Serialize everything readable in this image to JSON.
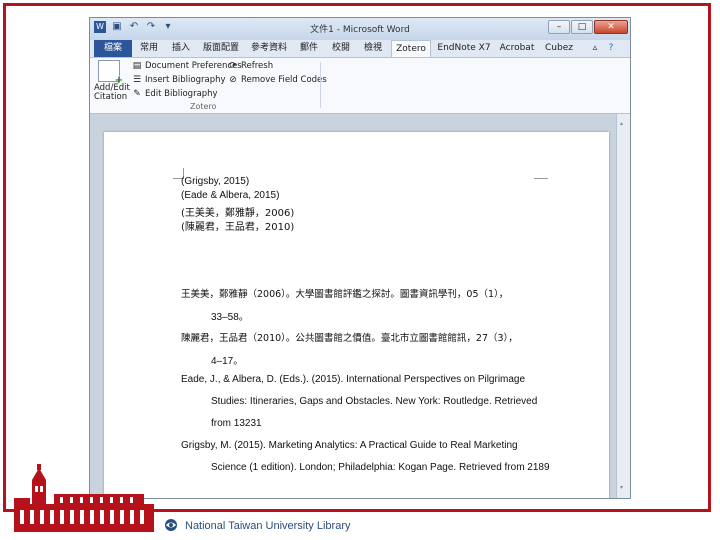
{
  "window": {
    "title": "文件1 - Microsoft Word",
    "qat_icons": [
      "word-app-icon",
      "save-icon",
      "undo-icon",
      "redo-icon",
      "customize-qat-icon"
    ],
    "controls": {
      "minimize": "–",
      "maximize": "□",
      "close": "✕"
    }
  },
  "tabs": [
    {
      "label": "檔案",
      "name": "tab-file"
    },
    {
      "label": "常用",
      "name": "tab-home"
    },
    {
      "label": "插入",
      "name": "tab-insert"
    },
    {
      "label": "版面配置",
      "name": "tab-page-layout"
    },
    {
      "label": "參考資料",
      "name": "tab-references"
    },
    {
      "label": "郵件",
      "name": "tab-mailings"
    },
    {
      "label": "校閱",
      "name": "tab-review"
    },
    {
      "label": "檢視",
      "name": "tab-view"
    },
    {
      "label": "Zotero",
      "name": "tab-zotero"
    },
    {
      "label": "EndNote X7",
      "name": "tab-endnote"
    },
    {
      "label": "Acrobat",
      "name": "tab-acrobat"
    },
    {
      "label": "Cubez",
      "name": "tab-cubez"
    }
  ],
  "ribbon": {
    "add_edit_citation": "Add/Edit Citation",
    "document_preferences": "Document Preferences",
    "insert_bibliography": "Insert Bibliography",
    "edit_bibliography": "Edit Bibliography",
    "refresh": "Refresh",
    "remove_field_codes": "Remove Field Codes",
    "group_label": "Zotero"
  },
  "document": {
    "citations": [
      "(Grigsby, 2015)",
      "(Eade & Albera, 2015)",
      "(王美美，鄭雅靜，2006)",
      "(陳麗君，王品君，2010)"
    ],
    "bibliography": [
      "王美美，鄭雅靜（2006）。大學圖書館評鑑之探討。圖書資訊學刊，05（1），",
      "33–58。",
      "陳麗君，王品君（2010）。公共圖書館之價值。臺北市立圖書館館訊，27（3），",
      "4–17。",
      "Eade, J., & Albera, D. (Eds.). (2015). International Perspectives on Pilgrimage",
      "Studies: Itineraries, Gaps and Obstacles. New York: Routledge. Retrieved",
      "from 13231",
      "Grigsby, M. (2015). Marketing Analytics: A Practical Guide to Real Marketing",
      "Science (1 edition). London; Philadelphia: Kogan Page. Retrieved from 2189"
    ]
  },
  "footer": {
    "library_name": "National Taiwan University Library"
  },
  "colors": {
    "frame_border": "#b5121b",
    "file_tab": "#2b579a",
    "logo_red": "#b5121b",
    "library_text": "#2a4f7f"
  }
}
